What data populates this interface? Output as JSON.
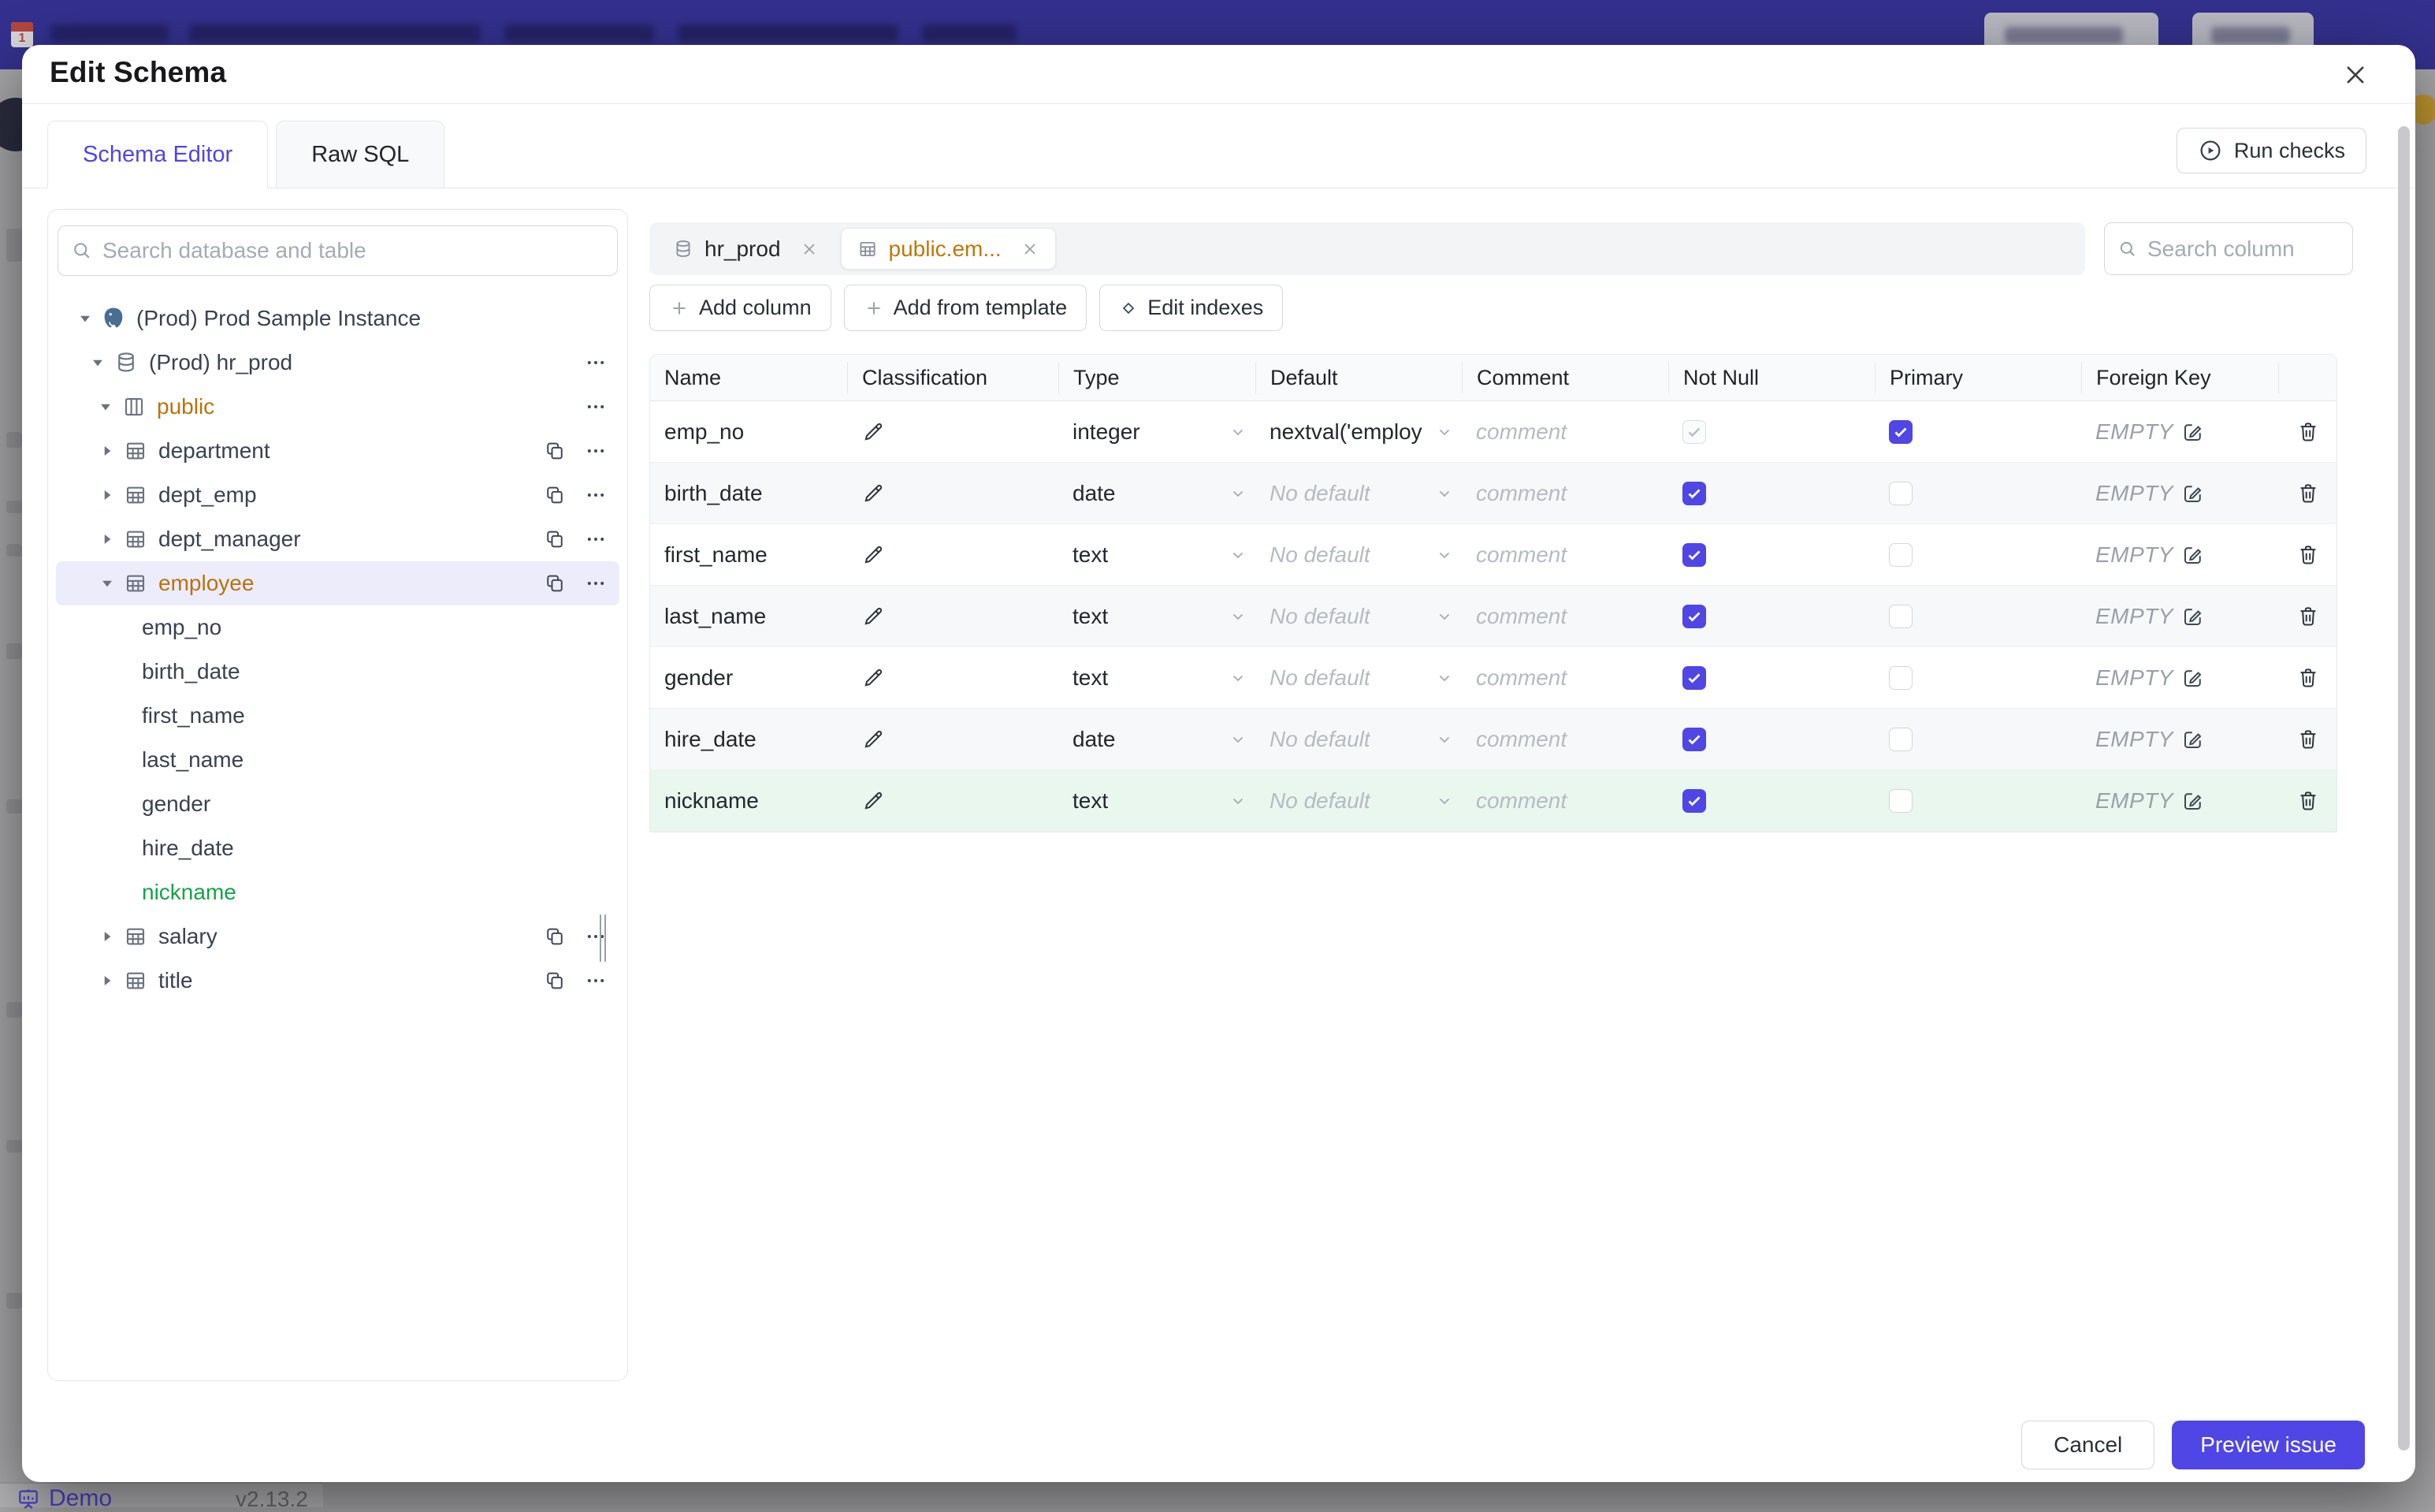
{
  "page": {
    "backdrop": {
      "demo_label": "Demo",
      "version": "v2.13.2"
    }
  },
  "modal": {
    "title": "Edit Schema",
    "tabs": [
      {
        "label": "Schema Editor",
        "active": true
      },
      {
        "label": "Raw SQL",
        "active": false
      }
    ],
    "run_checks": "Run checks",
    "sidebar": {
      "search_placeholder": "Search database and table",
      "tree": [
        {
          "label": "(Prod) Prod Sample Instance",
          "level": 0,
          "caret": "expanded",
          "icon": "postgres"
        },
        {
          "label": "(Prod) hr_prod",
          "level": 1,
          "caret": "expanded",
          "icon": "database",
          "more": true
        },
        {
          "label": "public",
          "level": 2,
          "caret": "expanded",
          "icon": "schema",
          "state": "modified",
          "more": true
        },
        {
          "label": "department",
          "level": 3,
          "caret": "collapsed",
          "icon": "table",
          "copy": true,
          "more": true
        },
        {
          "label": "dept_emp",
          "level": 3,
          "caret": "collapsed",
          "icon": "table",
          "copy": true,
          "more": true
        },
        {
          "label": "dept_manager",
          "level": 3,
          "caret": "collapsed",
          "icon": "table",
          "copy": true,
          "more": true
        },
        {
          "label": "employee",
          "level": 3,
          "caret": "expanded",
          "icon": "table",
          "state": "modified",
          "selected": true,
          "copy": true,
          "more": true
        },
        {
          "label": "emp_no",
          "level": 4
        },
        {
          "label": "birth_date",
          "level": 4
        },
        {
          "label": "first_name",
          "level": 4
        },
        {
          "label": "last_name",
          "level": 4
        },
        {
          "label": "gender",
          "level": 4
        },
        {
          "label": "hire_date",
          "level": 4
        },
        {
          "label": "nickname",
          "level": 4,
          "state": "added"
        },
        {
          "label": "salary",
          "level": 3,
          "caret": "collapsed",
          "icon": "table",
          "copy": true,
          "more": true
        },
        {
          "label": "title",
          "level": 3,
          "caret": "collapsed",
          "icon": "table",
          "copy": true,
          "more": true
        }
      ]
    },
    "selection_bar": {
      "chips": [
        {
          "label": "hr_prod",
          "icon": "database",
          "active": false,
          "modified": false
        },
        {
          "label": "public.em...",
          "icon": "table",
          "active": true,
          "modified": true
        }
      ],
      "search_placeholder": "Search column"
    },
    "toolbar": [
      {
        "label": "Add column",
        "icon": "plus"
      },
      {
        "label": "Add from template",
        "icon": "plus"
      },
      {
        "label": "Edit indexes",
        "icon": "diamond"
      }
    ],
    "table": {
      "headers": [
        "Name",
        "Classification",
        "Type",
        "Default",
        "Comment",
        "Not Null",
        "Primary",
        "Foreign Key",
        ""
      ],
      "comment_placeholder": "comment",
      "fk_placeholder": "EMPTY",
      "rows": [
        {
          "name": "emp_no",
          "type": "integer",
          "default": "nextval('employ",
          "default_is_value": true,
          "not_null": true,
          "not_null_disabled": true,
          "primary": true
        },
        {
          "name": "birth_date",
          "type": "date",
          "default": "No default",
          "default_is_value": false,
          "not_null": true,
          "not_null_disabled": false,
          "primary": false
        },
        {
          "name": "first_name",
          "type": "text",
          "default": "No default",
          "default_is_value": false,
          "not_null": true,
          "not_null_disabled": false,
          "primary": false
        },
        {
          "name": "last_name",
          "type": "text",
          "default": "No default",
          "default_is_value": false,
          "not_null": true,
          "not_null_disabled": false,
          "primary": false
        },
        {
          "name": "gender",
          "type": "text",
          "default": "No default",
          "default_is_value": false,
          "not_null": true,
          "not_null_disabled": false,
          "primary": false
        },
        {
          "name": "hire_date",
          "type": "date",
          "default": "No default",
          "default_is_value": false,
          "not_null": true,
          "not_null_disabled": false,
          "primary": false
        },
        {
          "name": "nickname",
          "type": "text",
          "default": "No default",
          "default_is_value": false,
          "not_null": true,
          "not_null_disabled": false,
          "primary": false,
          "state": "added"
        }
      ]
    },
    "footer": {
      "cancel": "Cancel",
      "primary": "Preview issue"
    }
  },
  "colors": {
    "accent": "#4f46e5",
    "topbar": "#34318f",
    "modified_text": "#b9730d",
    "added_text": "#16a34a",
    "added_row_bg": "#e9f7ef",
    "selected_row_bg": "#edecfb"
  }
}
